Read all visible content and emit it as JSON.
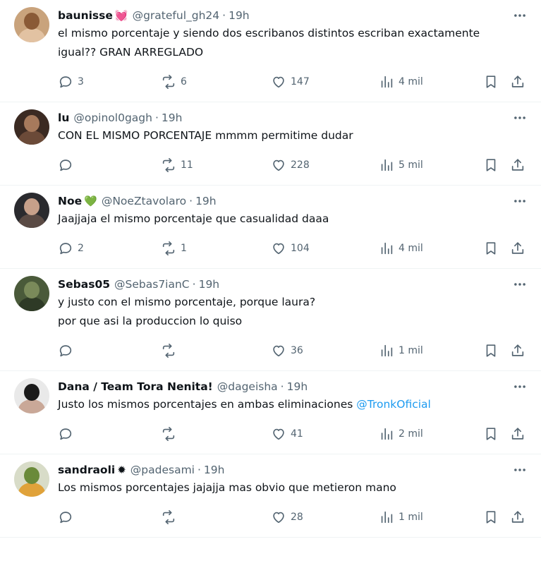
{
  "replies": [
    {
      "name": "baunisse",
      "badge": "💓",
      "handle": "@grateful_gh24",
      "time": "19h",
      "lines": [
        "el mismo porcentaje y siendo dos escribanos distintos escriban exactamente",
        "igual?? GRAN ARREGLADO"
      ],
      "replies": "3",
      "reposts": "6",
      "likes": "147",
      "views": "4 mil",
      "avatar": [
        "#c9a37c",
        "#8a5a36",
        "#e2c2a2"
      ]
    },
    {
      "name": "lu",
      "badge": "",
      "handle": "@opinol0gagh",
      "time": "19h",
      "lines": [
        "CON EL MISMO PORCENTAJE mmmm permitime dudar"
      ],
      "replies": "",
      "reposts": "11",
      "likes": "228",
      "views": "5 mil",
      "avatar": [
        "#3b2a22",
        "#a77a5c",
        "#6b4a38"
      ]
    },
    {
      "name": "Noe",
      "badge": "💚",
      "handle": "@NoeZtavolaro",
      "time": "19h",
      "lines": [
        "Jaajjaja el mismo porcentaje que casualidad daaa"
      ],
      "replies": "2",
      "reposts": "1",
      "likes": "104",
      "views": "4 mil",
      "avatar": [
        "#2a2a2e",
        "#c7a08a",
        "#5a4a44"
      ]
    },
    {
      "name": "Sebas05",
      "badge": "",
      "handle": "@Sebas7ianC",
      "time": "19h",
      "lines": [
        "y justo con el mismo porcentaje, porque laura?",
        "por que asi la produccion lo quiso"
      ],
      "replies": "",
      "reposts": "",
      "likes": "36",
      "views": "1 mil",
      "avatar": [
        "#4a5a3a",
        "#7a8a5a",
        "#2e3a26"
      ]
    },
    {
      "name": "Dana / Team Tora Nenita!",
      "badge": "",
      "handle": "@dageisha",
      "time": "19h",
      "lines": [
        "Justo los mismos porcentajes en ambas eliminaciones "
      ],
      "mention": "@TronkOficial",
      "replies": "",
      "reposts": "",
      "likes": "41",
      "views": "2 mil",
      "avatar": [
        "#e9e9e9",
        "#1a1a1a",
        "#c9a898"
      ]
    },
    {
      "name": "sandraoli",
      "badge": "✹",
      "handle": "@padesami",
      "time": "19h",
      "lines": [
        "Los mismos porcentajes jajajja mas obvio que metieron mano"
      ],
      "replies": "",
      "reposts": "",
      "likes": "28",
      "views": "1 mil",
      "avatar": [
        "#d8dcc8",
        "#6a8a3a",
        "#e0a23a"
      ]
    }
  ],
  "icons": {
    "more": "more-icon",
    "reply": "reply-icon",
    "repost": "repost-icon",
    "like": "heart-icon",
    "views": "views-icon",
    "bookmark": "bookmark-icon",
    "share": "share-icon"
  },
  "colors": {
    "text": "#0f1419",
    "muted": "#536471",
    "link": "#1d9bf0",
    "border": "#eff3f4"
  }
}
